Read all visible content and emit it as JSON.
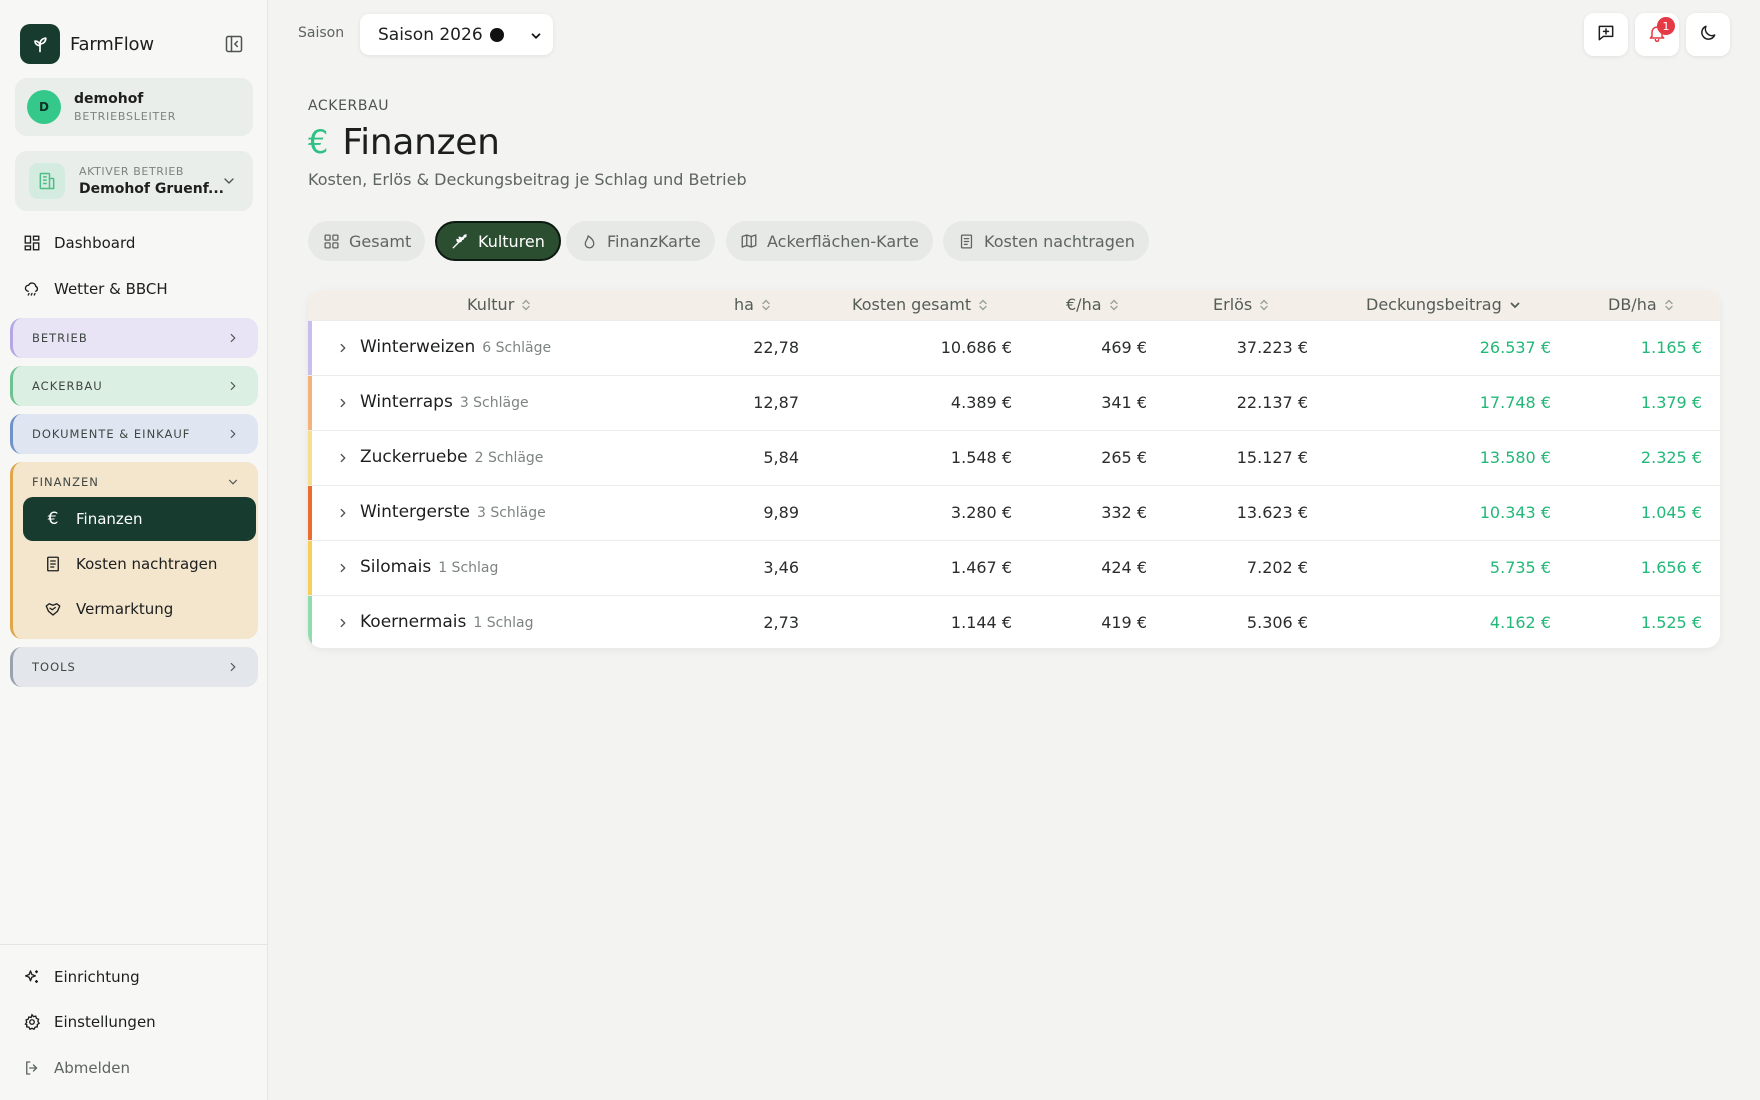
{
  "app": {
    "name": "FarmFlow"
  },
  "user": {
    "initial": "D",
    "name": "demohof",
    "role": "BETRIEBSLEITER"
  },
  "farm": {
    "label": "AKTIVER BETRIEB",
    "name": "Demohof Gruenf..."
  },
  "nav": {
    "dashboard": "Dashboard",
    "weather": "Wetter & BBCH"
  },
  "groups": {
    "betrieb": "BETRIEB",
    "ackerbau": "ACKERBAU",
    "dokumente": "DOKUMENTE & EINKAUF",
    "finanzen": "FINANZEN",
    "tools": "TOOLS"
  },
  "finanzen_items": [
    "Finanzen",
    "Kosten nachtragen",
    "Vermarktung"
  ],
  "footer_nav": {
    "setup": "Einrichtung",
    "settings": "Einstellungen",
    "logout": "Abmelden"
  },
  "topbar": {
    "season_label": "Saison",
    "season_value": "Saison 2026",
    "notification_count": "1"
  },
  "header": {
    "eyebrow": "ACKERBAU",
    "icon": "€",
    "title": "Finanzen",
    "subtitle": "Kosten, Erlös & Deckungsbeitrag je Schlag und Betrieb"
  },
  "tabs": [
    "Gesamt",
    "Kulturen",
    "FinanzKarte",
    "Ackerflächen-Karte",
    "Kosten nachtragen"
  ],
  "active_tab": "Kulturen",
  "table": {
    "columns": [
      "Kultur",
      "ha",
      "Kosten gesamt",
      "€/ha",
      "Erlös",
      "Deckungsbeitrag",
      "DB/ha"
    ],
    "sorted_column": "Deckungsbeitrag",
    "rows": [
      {
        "crop": "Winterweizen",
        "fields": "6 Schläge",
        "ha": "22,78",
        "kosten": "10.686 €",
        "eur_ha": "469 €",
        "erloes": "37.223 €",
        "db": "26.537 €",
        "db_ha": "1.165 €",
        "color": "#c9bdf0"
      },
      {
        "crop": "Winterraps",
        "fields": "3 Schläge",
        "ha": "12,87",
        "kosten": "4.389 €",
        "eur_ha": "341 €",
        "erloes": "22.137 €",
        "db": "17.748 €",
        "db_ha": "1.379 €",
        "color": "#f2b27a"
      },
      {
        "crop": "Zuckerruebe",
        "fields": "2 Schläge",
        "ha": "5,84",
        "kosten": "1.548 €",
        "eur_ha": "265 €",
        "erloes": "15.127 €",
        "db": "13.580 €",
        "db_ha": "2.325 €",
        "color": "#f7dd8e"
      },
      {
        "crop": "Wintergerste",
        "fields": "3 Schläge",
        "ha": "9,89",
        "kosten": "3.280 €",
        "eur_ha": "332 €",
        "erloes": "13.623 €",
        "db": "10.343 €",
        "db_ha": "1.045 €",
        "color": "#ea6d2d"
      },
      {
        "crop": "Silomais",
        "fields": "1 Schlag",
        "ha": "3,46",
        "kosten": "1.467 €",
        "eur_ha": "424 €",
        "erloes": "7.202 €",
        "db": "5.735 €",
        "db_ha": "1.656 €",
        "color": "#f5cf5a"
      },
      {
        "crop": "Koernermais",
        "fields": "1 Schlag",
        "ha": "2,73",
        "kosten": "1.144 €",
        "eur_ha": "419 €",
        "erloes": "5.306 €",
        "db": "4.162 €",
        "db_ha": "1.525 €",
        "color": "#8fdcae"
      }
    ]
  },
  "colors": {
    "brand_dark": "#173b2e",
    "accent_green": "#22b877",
    "active_tab": "#2b4e30",
    "badge_red": "#e53a45"
  }
}
